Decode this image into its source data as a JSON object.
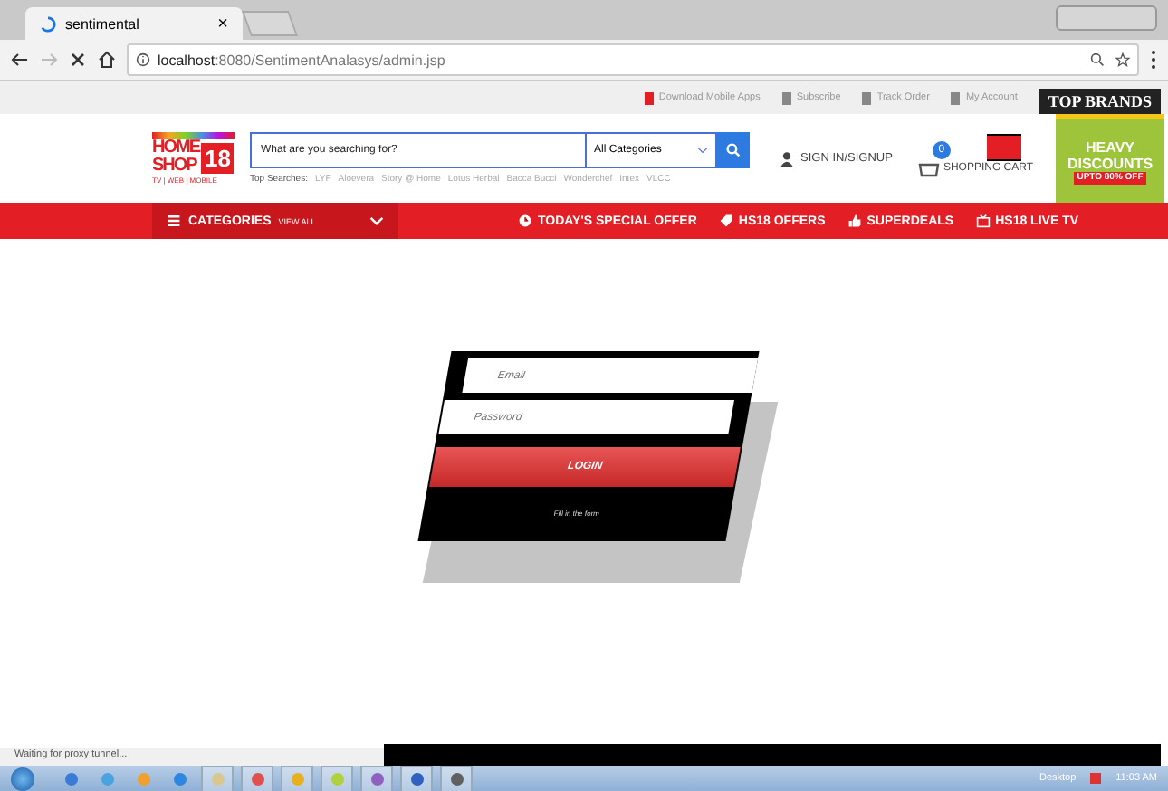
{
  "browser": {
    "tab": {
      "title": "sentimental",
      "close": "×"
    },
    "address": "**localhost**:8080/SentimentAnalasys/admin.jsp"
  },
  "top_links": [
    "Download Mobile Apps",
    "Subscribe",
    "Track Order",
    "My Account"
  ],
  "promo_title": "TOP BRANDS",
  "logo": {
    "line1": "HOME",
    "line2": "SHOP",
    "number": "18",
    "tagline": "TV | WEB | MOBILE"
  },
  "search": {
    "placeholder": "What are you searching for?",
    "category": "All Categories"
  },
  "top_searches": {
    "label": "Top Searches:",
    "items": [
      "LYF",
      "Aloevera",
      "Story @ Home",
      "Lotus Herbal",
      "Bacca Bucci",
      "Wonderchef",
      "Intex",
      "VLCC"
    ]
  },
  "sign_in": "SIGN IN/SIGNUP",
  "cart": {
    "count": "0",
    "label": "SHOPPING CART"
  },
  "ad": {
    "line1": "HEAVY",
    "line2": "DISCOUNTS",
    "line3": "UPTO 80% OFF"
  },
  "nav": {
    "categories": "CATEGORIES",
    "view_all": "VIEW ALL",
    "items": [
      {
        "kind": "clock",
        "label": "TODAY'S SPECIAL OFFER"
      },
      {
        "kind": "tag",
        "label": "HS18 OFFERS"
      },
      {
        "kind": "thumb",
        "label": "SUPERDEALS"
      },
      {
        "kind": "tv",
        "label": "HS18 LIVE TV"
      }
    ]
  },
  "login": {
    "email_placeholder": "Email",
    "password_placeholder": "Password",
    "button": "LOGIN",
    "note": "Fill in the form"
  },
  "status_bar": "Waiting for proxy tunnel...",
  "taskbar": {
    "desktop": "Desktop",
    "time": "11:03 AM"
  }
}
